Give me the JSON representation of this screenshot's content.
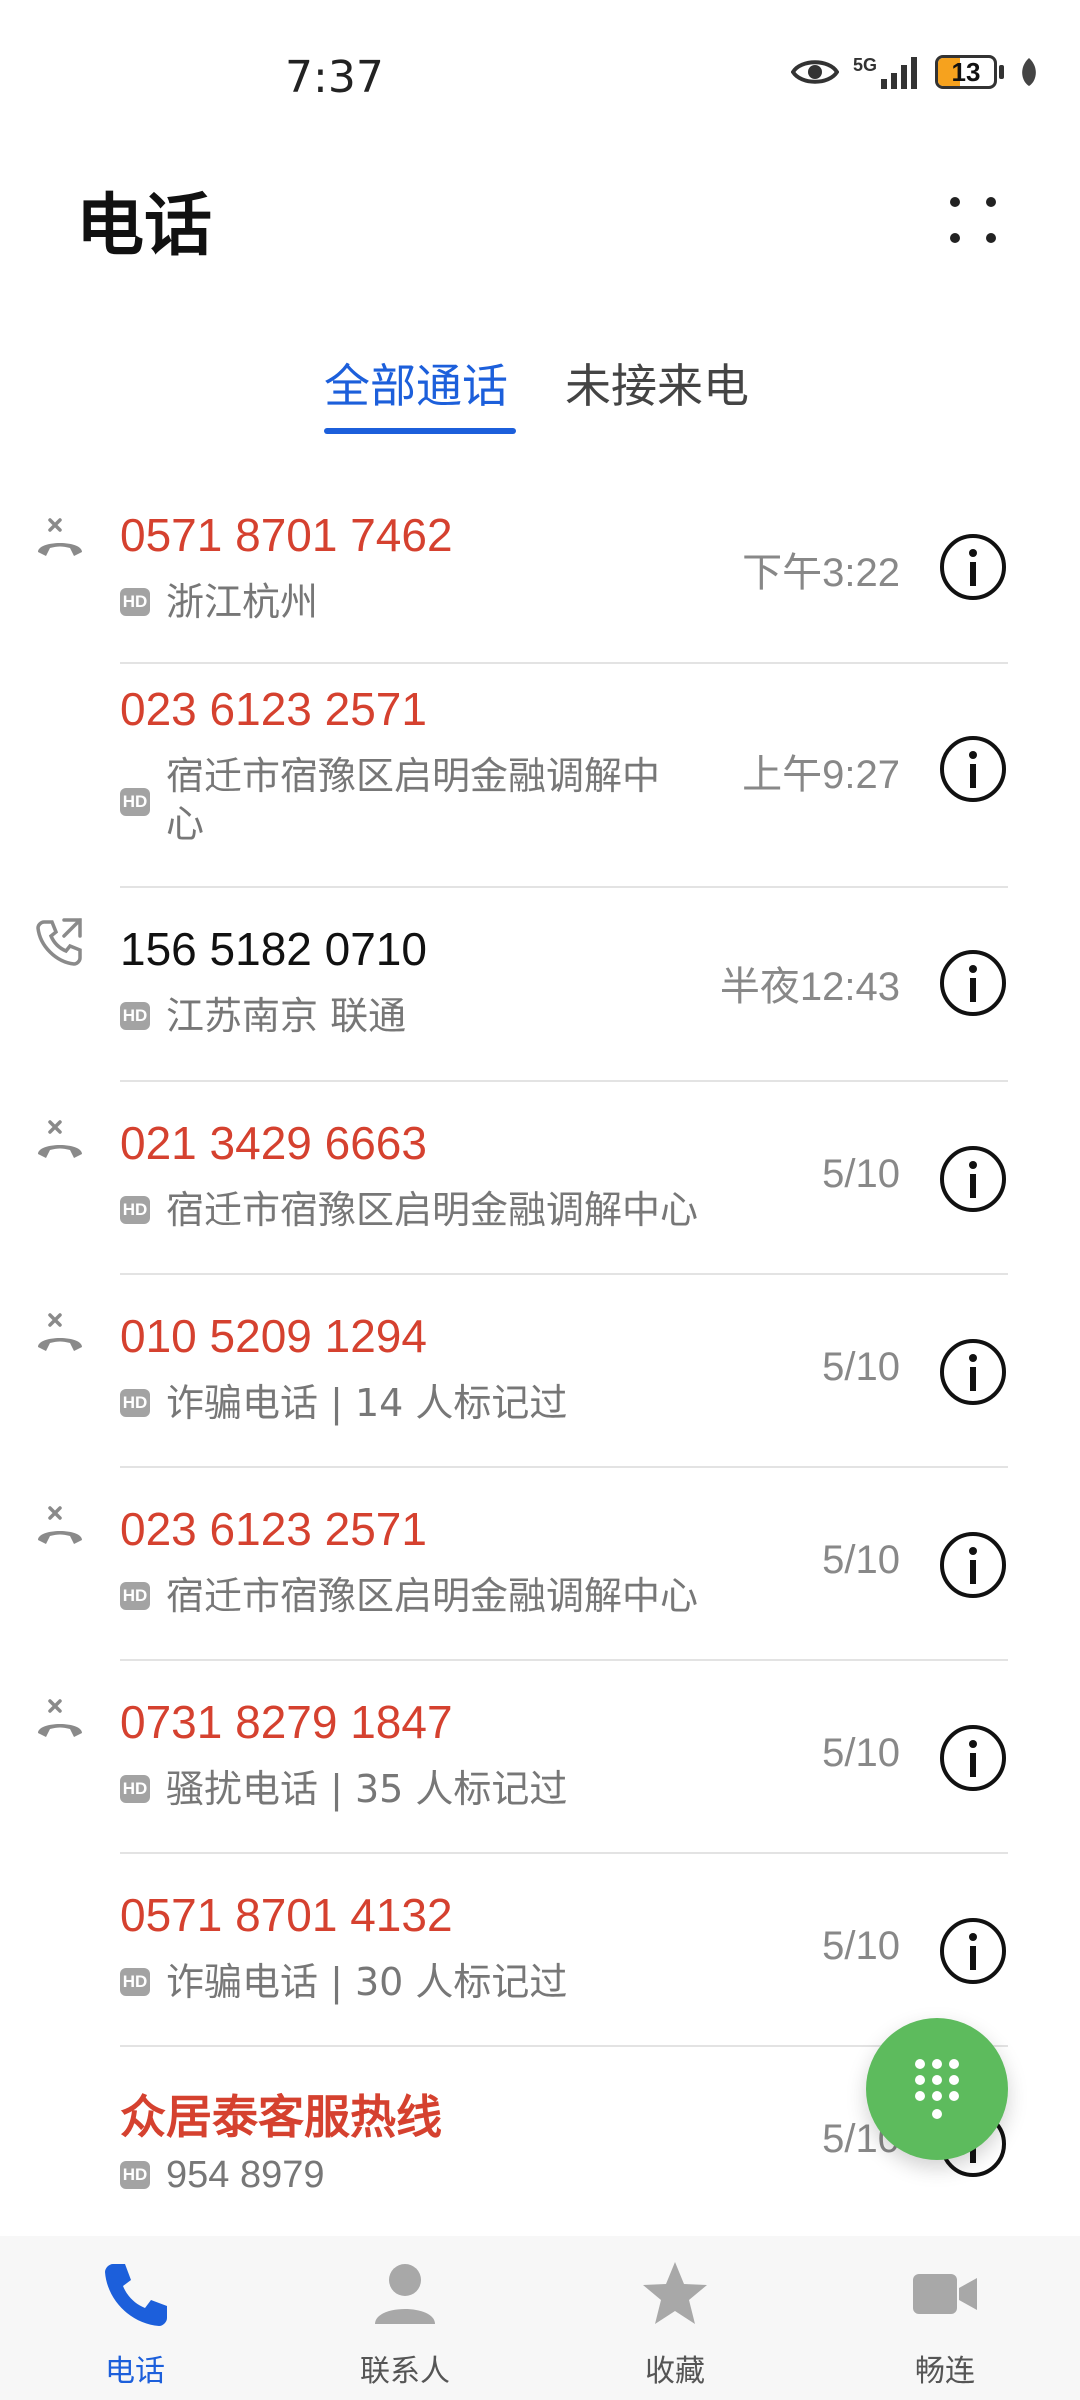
{
  "status_bar": {
    "time": "7:37",
    "network": "5G",
    "battery": "13",
    "battery_level_percent": 13
  },
  "header": {
    "title": "电话"
  },
  "tabs": [
    {
      "label": "全部通话",
      "active": true
    },
    {
      "label": "未接来电",
      "active": false
    }
  ],
  "calls": [
    {
      "number": "0571 8701 7462",
      "subtitle": "浙江杭州",
      "time": "下午3:22",
      "type": "missed",
      "icon": "missed-call-icon"
    },
    {
      "number": "023 6123 2571",
      "subtitle": "宿迁市宿豫区启明金融调解中心",
      "time": "上午9:27",
      "type": "missed",
      "icon": "none"
    },
    {
      "number": "156 5182 0710",
      "subtitle": "江苏南京 联通",
      "time": "半夜12:43",
      "type": "outgoing",
      "icon": "outgoing-call-icon"
    },
    {
      "number": "021 3429 6663",
      "subtitle": "宿迁市宿豫区启明金融调解中心",
      "time": "5/10",
      "type": "missed",
      "icon": "missed-call-icon"
    },
    {
      "number": "010 5209 1294",
      "subtitle": "诈骗电话 | 14 人标记过",
      "time": "5/10",
      "type": "missed",
      "icon": "missed-call-icon"
    },
    {
      "number": "023 6123 2571",
      "subtitle": "宿迁市宿豫区启明金融调解中心",
      "time": "5/10",
      "type": "missed",
      "icon": "missed-call-icon"
    },
    {
      "number": "0731 8279 1847",
      "subtitle": "骚扰电话 | 35 人标记过",
      "time": "5/10",
      "type": "missed",
      "icon": "missed-call-icon"
    },
    {
      "number": "0571 8701 4132",
      "subtitle": "诈骗电话 | 30 人标记过",
      "time": "5/10",
      "type": "missed",
      "icon": "none"
    },
    {
      "number": "众居泰客服热线",
      "subtitle": "954 8979",
      "time": "5/10",
      "type": "missed",
      "icon": "none"
    }
  ],
  "hd_badge": "HD",
  "bottom_nav": [
    {
      "label": "电话",
      "icon": "phone-icon",
      "active": true
    },
    {
      "label": "联系人",
      "icon": "contacts-icon",
      "active": false
    },
    {
      "label": "收藏",
      "icon": "star-icon",
      "active": false
    },
    {
      "label": "畅连",
      "icon": "video-call-icon",
      "active": false
    }
  ],
  "colors": {
    "accent": "#1c5fdb",
    "missed": "#d5412f",
    "fab": "#5dbb5d"
  }
}
